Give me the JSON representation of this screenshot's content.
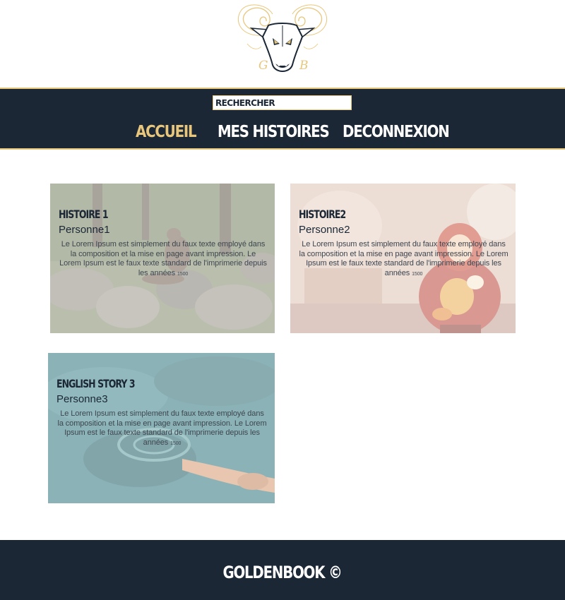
{
  "brand": {
    "logo_icon": "ram-head-logo-icon",
    "initials_left": "G",
    "initials_right": "B",
    "color_gold": "#e8c77d",
    "color_navy": "#1b2735"
  },
  "search": {
    "placeholder": "RECHERCHER"
  },
  "nav": {
    "items": [
      {
        "label": "ACCUEIL",
        "active": true
      },
      {
        "label": "MES HISTOIRES",
        "active": false
      },
      {
        "label": "DECONNEXION",
        "active": false
      }
    ]
  },
  "stories": [
    {
      "title": "HISTOIRE 1",
      "author": "Personne1",
      "excerpt": "Le Lorem Ipsum est simplement du faux texte employé dans la composition et la mise en page avant impression. Le Lorem Ipsum est le faux texte standard de l'imprimerie depuis les années",
      "excerpt_small": "1500",
      "image": "otter-on-rocks-image"
    },
    {
      "title": "HISTOIRE2",
      "author": "Personne2",
      "excerpt": "Le Lorem Ipsum est simplement du faux texte employé dans la composition et la mise en page avant impression. Le Lorem Ipsum est le faux texte standard de l'imprimerie depuis les années",
      "excerpt_small": "1500",
      "image": "matryoshka-doll-image"
    },
    {
      "title": "ENGLISH STORY 3",
      "author": "Personne3",
      "excerpt": "Le Lorem Ipsum est simplement du faux texte employé dans la composition et la mise en page avant impression. Le Lorem Ipsum est le faux texte standard de l'imprimerie depuis les années",
      "excerpt_small": "1500",
      "image": "swimmer-in-water-image"
    }
  ],
  "footer": {
    "text": "GOLDENBOOK ©"
  }
}
